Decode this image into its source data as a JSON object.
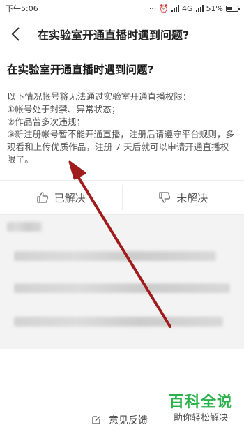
{
  "status_bar": {
    "time": "下午5:06",
    "network": "4G",
    "battery": "51%",
    "battery_level": 0.51
  },
  "nav": {
    "title": "在实验室开通直播时遇到问题?"
  },
  "article": {
    "title": "在实验室开通直播时遇到问题?",
    "lines": [
      "以下情况帐号将无法通过实验室开通直播权限：",
      "①帐号处于封禁、异常状态；",
      "②作品曾多次违规；",
      "③新注册帐号暂不能开通直播，注册后请遵守平台规则，多观看和上传优质作品，注册 7 天后就可以申请开通直播权限了。"
    ]
  },
  "feedback": {
    "solved": "已解决",
    "unsolved": "未解决"
  },
  "bottom": {
    "feedback_link": "意见反馈"
  },
  "watermark": {
    "brand": "百科全说",
    "slogan": "助你轻松解决"
  },
  "colors": {
    "annotation_arrow": "#a01c1c",
    "watermark_green": "#2bb24c"
  }
}
